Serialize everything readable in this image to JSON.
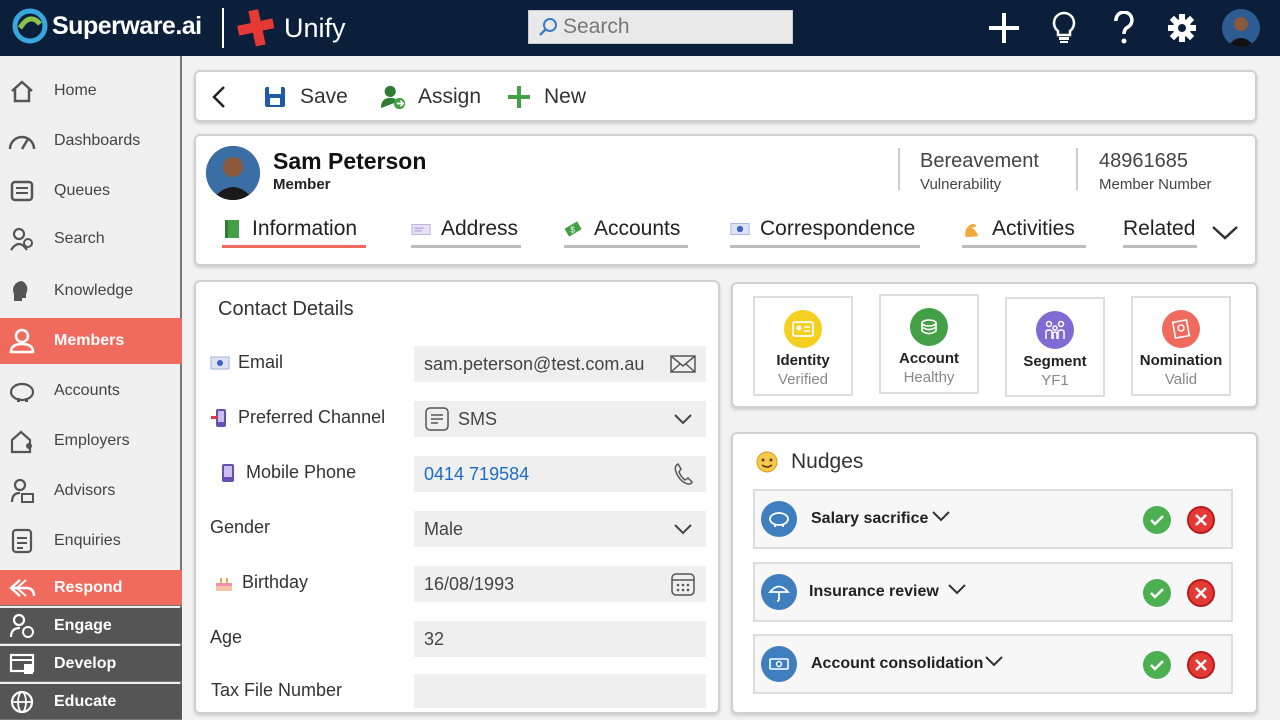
{
  "app": {
    "brand": "Superware.ai",
    "product": "Unify"
  },
  "search": {
    "placeholder": "Search"
  },
  "sidebar": {
    "items": [
      {
        "label": "Home",
        "icon": "home-icon"
      },
      {
        "label": "Dashboards",
        "icon": "gauge-icon"
      },
      {
        "label": "Queues",
        "icon": "inbox-icon"
      },
      {
        "label": "Search",
        "icon": "people-search-icon"
      },
      {
        "label": "Knowledge",
        "icon": "brain-icon"
      },
      {
        "label": "Members",
        "icon": "person-icon",
        "active": true
      },
      {
        "label": "Accounts",
        "icon": "piggy-bank-icon"
      },
      {
        "label": "Employers",
        "icon": "building-person-icon"
      },
      {
        "label": "Advisors",
        "icon": "advisor-icon"
      },
      {
        "label": "Enquiries",
        "icon": "document-list-icon"
      }
    ],
    "bottom": [
      {
        "label": "Respond",
        "icon": "reply-icon"
      },
      {
        "label": "Engage",
        "icon": "engage-icon"
      },
      {
        "label": "Develop",
        "icon": "develop-icon"
      },
      {
        "label": "Educate",
        "icon": "globe-icon"
      }
    ]
  },
  "toolbar": {
    "save_label": "Save",
    "assign_label": "Assign",
    "new_label": "New"
  },
  "member": {
    "name": "Sam Peterson",
    "role": "Member",
    "vulnerability_value": "Bereavement",
    "vulnerability_label": "Vulnerability",
    "number_value": "48961685",
    "number_label": "Member Number"
  },
  "tabs": [
    {
      "label": "Information",
      "active": true
    },
    {
      "label": "Address"
    },
    {
      "label": "Accounts"
    },
    {
      "label": "Correspondence"
    },
    {
      "label": "Activities"
    },
    {
      "label": "Related"
    }
  ],
  "contact": {
    "title": "Contact Details",
    "email_label": "Email",
    "email_value": "sam.peterson@test.com.au",
    "channel_label": "Preferred Channel",
    "channel_value": "SMS",
    "mobile_label": "Mobile Phone",
    "mobile_value": "0414 719584",
    "gender_label": "Gender",
    "gender_value": "Male",
    "birthday_label": "Birthday",
    "birthday_value": "16/08/1993",
    "age_label": "Age",
    "age_value": "32",
    "tfn_label": "Tax File Number",
    "tfn_value": ""
  },
  "badges": [
    {
      "title": "Identity",
      "status": "Verified",
      "color": "#f5d020"
    },
    {
      "title": "Account",
      "status": "Healthy",
      "color": "#43a047"
    },
    {
      "title": "Segment",
      "status": "YF1",
      "color": "#7e6bd3"
    },
    {
      "title": "Nomination",
      "status": "Valid",
      "color": "#f06a5d"
    }
  ],
  "nudges": {
    "title": "Nudges",
    "items": [
      {
        "label": "Salary sacrifice",
        "icon": "piggy-bank-icon"
      },
      {
        "label": "Insurance review",
        "icon": "umbrella-icon"
      },
      {
        "label": "Account consolidation",
        "icon": "money-icon"
      }
    ]
  },
  "colors": {
    "accent": "#f06a5d",
    "topbar": "#0b1f3a",
    "link": "#1a6cc4"
  }
}
